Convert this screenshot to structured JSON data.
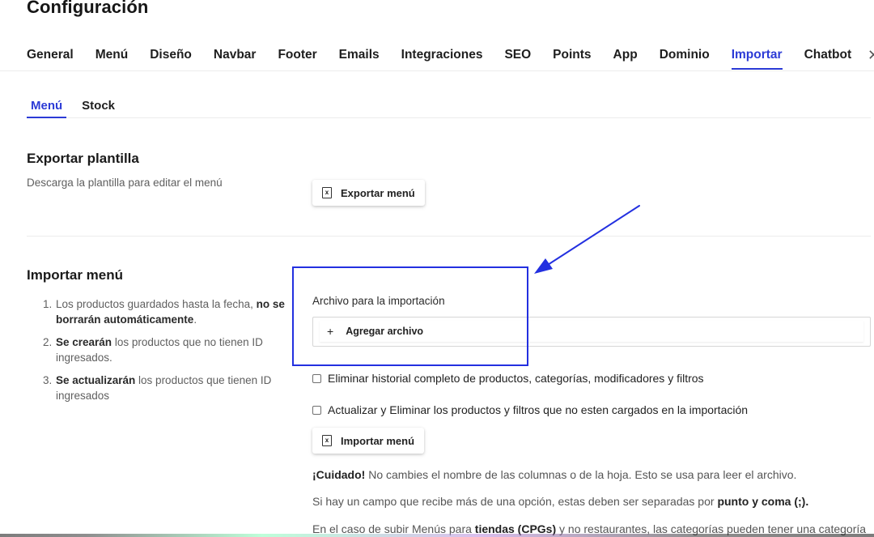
{
  "page": {
    "title": "Configuración"
  },
  "main_tabs": [
    {
      "label": "General"
    },
    {
      "label": "Menú"
    },
    {
      "label": "Diseño"
    },
    {
      "label": "Navbar"
    },
    {
      "label": "Footer"
    },
    {
      "label": "Emails"
    },
    {
      "label": "Integraciones"
    },
    {
      "label": "SEO"
    },
    {
      "label": "Points"
    },
    {
      "label": "App"
    },
    {
      "label": "Dominio"
    },
    {
      "label": "Importar",
      "active": true
    },
    {
      "label": "Chatbot"
    }
  ],
  "close_glyph": "✕",
  "sub_tabs": [
    {
      "label": "Menú",
      "active": true
    },
    {
      "label": "Stock"
    }
  ],
  "export": {
    "title": "Exportar plantilla",
    "description": "Descarga la plantilla para editar el menú",
    "button_label": "Exportar menú"
  },
  "import": {
    "title": "Importar menú",
    "steps": [
      {
        "num": "1.",
        "pre": "Los productos guardados hasta la fecha, ",
        "bold": "no se borrarán automáticamente",
        "post": "."
      },
      {
        "num": "2.",
        "pre": "",
        "bold": "Se crearán",
        "post": " los productos que no tienen ID ingresados."
      },
      {
        "num": "3.",
        "pre": "",
        "bold": "Se actualizarán",
        "post": " los productos que tienen ID ingresados"
      }
    ],
    "file_label": "Archivo para la importación",
    "add_file_label": "Agregar archivo",
    "checkbox_1": "Eliminar historial completo de productos, categorías, modificadores y filtros",
    "checkbox_2": "Actualizar y Eliminar los productos y filtros que no esten cargados en la importación",
    "button_label": "Importar menú",
    "note_1_bold": "¡Cuidado!",
    "note_1_rest": " No cambies el nombre de las columnas o de la hoja. Esto se usa para leer el archivo.",
    "note_2_pre": "Si hay un campo que recibe más de una opción, estas deben ser separadas por ",
    "note_2_bold": "punto y coma (;).",
    "note_3_pre": "En el caso de subir Menús para ",
    "note_3_bold": "tiendas (CPGs)",
    "note_3_post": " y no restaurantes, las categorías pueden tener una categoría"
  },
  "colors": {
    "accent": "#2c3bd6",
    "annotation": "#2330e0"
  }
}
